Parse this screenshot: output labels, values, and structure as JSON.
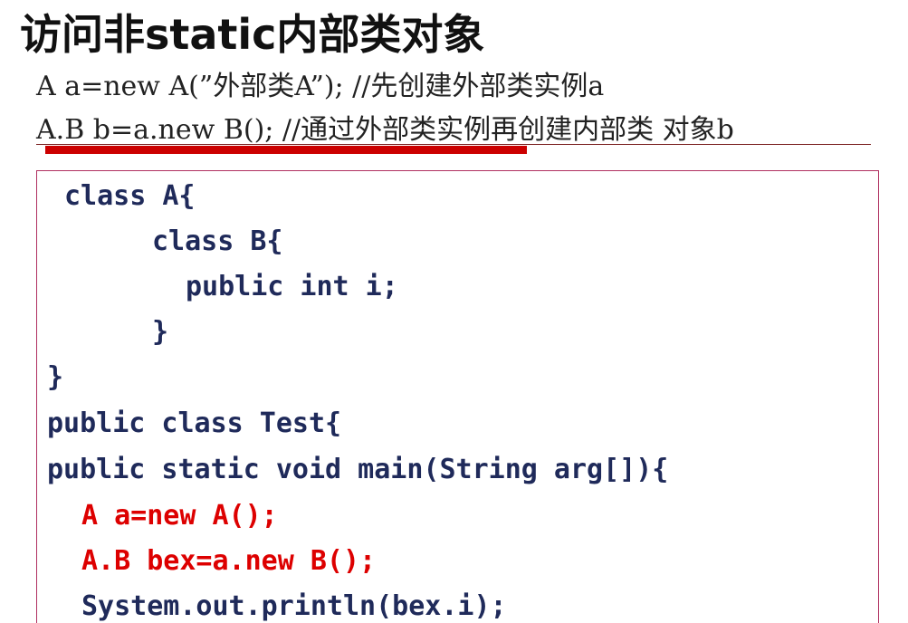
{
  "title": "访问非static内部类对象",
  "lines": {
    "line1": "A  a=new  A(”外部类A”); //先创建外部类实例a",
    "line2": "A.B  b=a.new  B(); //通过外部类实例再创建内部类 对象b"
  },
  "code": [
    "class A{",
    "class B{",
    "public int i;",
    "}",
    "}",
    "public class Test{",
    "public static void main(String arg[]){",
    "A a=new A();",
    "A.B bex=a.new B();",
    "System.out.println(bex.i);"
  ],
  "colors": {
    "code_text": "#1f2a5a",
    "highlight_text": "#dd0000",
    "accent_bar": "#cc0000"
  }
}
